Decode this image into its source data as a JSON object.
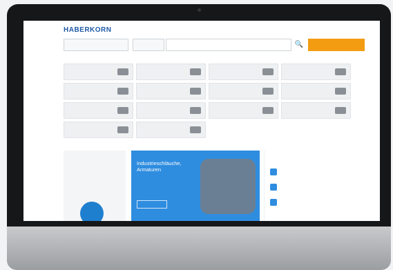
{
  "brand": {
    "logo_text": "HABERKORN"
  },
  "header": {
    "category_select": "",
    "scope_select": "",
    "search_placeholder": "",
    "cta_label": ""
  },
  "breadcrumb": [],
  "categories": [
    {
      "label": ""
    },
    {
      "label": ""
    },
    {
      "label": ""
    },
    {
      "label": ""
    },
    {
      "label": ""
    },
    {
      "label": ""
    },
    {
      "label": ""
    },
    {
      "label": ""
    },
    {
      "label": ""
    },
    {
      "label": ""
    },
    {
      "label": ""
    },
    {
      "label": ""
    },
    {
      "label": ""
    },
    {
      "label": ""
    }
  ],
  "promo_left": {
    "text": ""
  },
  "hero": {
    "headline": "Industrieschläuche, Armaturen",
    "subheadline": "",
    "button_label": ""
  },
  "benefits": {
    "title": "",
    "items": [
      {
        "text": ""
      },
      {
        "text": ""
      },
      {
        "text": ""
      }
    ]
  }
}
